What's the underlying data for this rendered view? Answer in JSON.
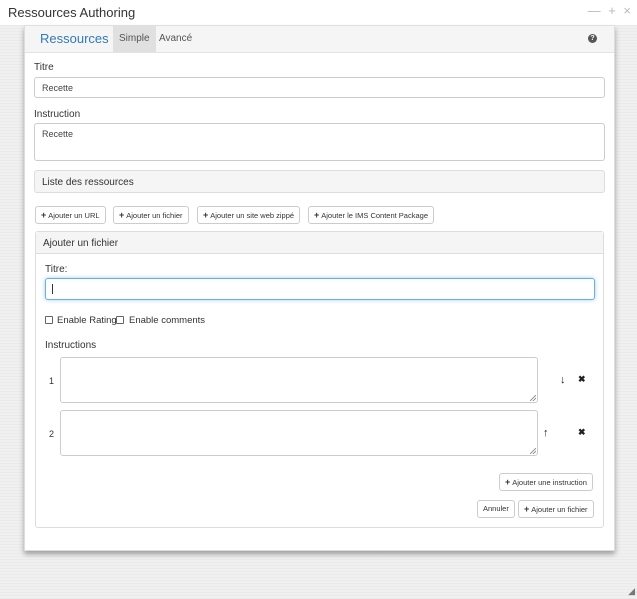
{
  "window": {
    "title": "Ressources Authoring",
    "controls": {
      "minimize": "—",
      "maximize": "+",
      "close": "×"
    }
  },
  "nav": {
    "brand": "Ressources",
    "tabs": [
      {
        "label": "Simple",
        "active": true
      },
      {
        "label": "Avancé",
        "active": false
      }
    ],
    "help_icon": "question-circle-icon",
    "help_glyph": "?"
  },
  "form": {
    "titre_label": "Titre",
    "titre_value": "Recette",
    "instruction_label": "Instruction",
    "instruction_value": "Recette"
  },
  "resource_list": {
    "header": "Liste des ressources",
    "buttons": [
      "Ajouter un URL",
      "Ajouter un fichier",
      "Ajouter un site web zippé",
      "Ajouter le IMS Content Package"
    ]
  },
  "add_file": {
    "header": "Ajouter un fichier",
    "titre_label": "Titre:",
    "titre_value": "",
    "enable_rating": "Enable Rating",
    "enable_comments": "Enable comments",
    "instructions_label": "Instructions",
    "instructions": [
      {
        "number": "1",
        "value": "",
        "action": "arrow-down-icon",
        "action_glyph": "↓",
        "delete_glyph": "✖"
      },
      {
        "number": "2",
        "value": "",
        "action": "arrow-up-icon",
        "action_glyph": "↑",
        "delete_glyph": "✖"
      }
    ],
    "add_instruction_button": "Ajouter une instruction",
    "cancel_button": "Annuler",
    "add_file_button": "Ajouter un fichier"
  },
  "plus_glyph": "+",
  "colors": {
    "brand": "#337ab7",
    "focus": "#66afe9",
    "active_tab": "#e0e0e0"
  }
}
